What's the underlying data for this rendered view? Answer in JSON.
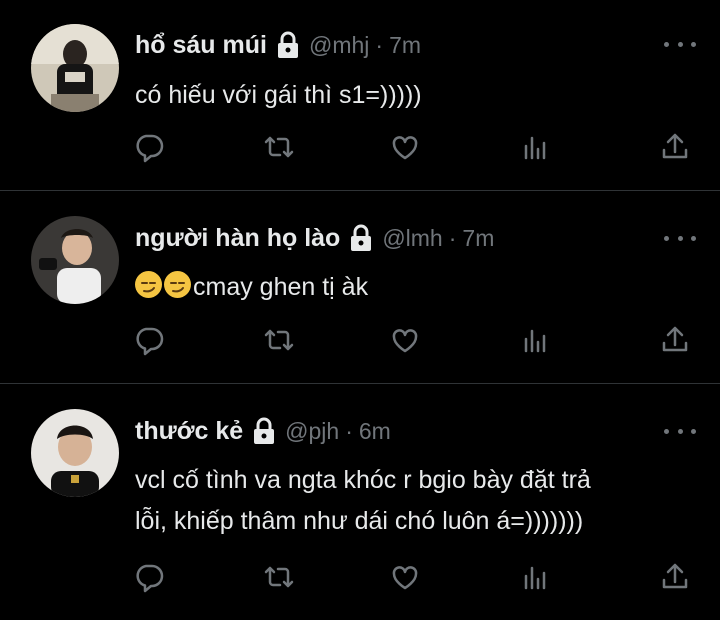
{
  "tweets": [
    {
      "name": "hổ sáu múi",
      "handle": "@mhj",
      "separator": "·",
      "time": "7m",
      "text": "có hiếu với gái thì s1=)))))",
      "emoji_count": 0
    },
    {
      "name": "người hàn họ lào",
      "handle": "@lmh",
      "separator": "·",
      "time": "7m",
      "text": "cmay ghen tị àk",
      "emoji_prefix": "😏😏"
    },
    {
      "name": "thước kẻ",
      "handle": "@pjh",
      "separator": "·",
      "time": "6m",
      "text_line1": "vcl cố tình va ngta khóc r bgio bày đặt trả",
      "text_line2": "lỗi, khiếp thâm như dái chó luôn á=)))))))"
    }
  ],
  "icons": {
    "reply": "reply-icon",
    "retweet": "retweet-icon",
    "like": "heart-icon",
    "views": "views-icon",
    "share": "share-icon",
    "more": "more-icon",
    "lock": "lock-icon"
  },
  "colors": {
    "background": "#000000",
    "text": "#e7e9ea",
    "muted": "#71767b",
    "divider": "#2f3336"
  }
}
